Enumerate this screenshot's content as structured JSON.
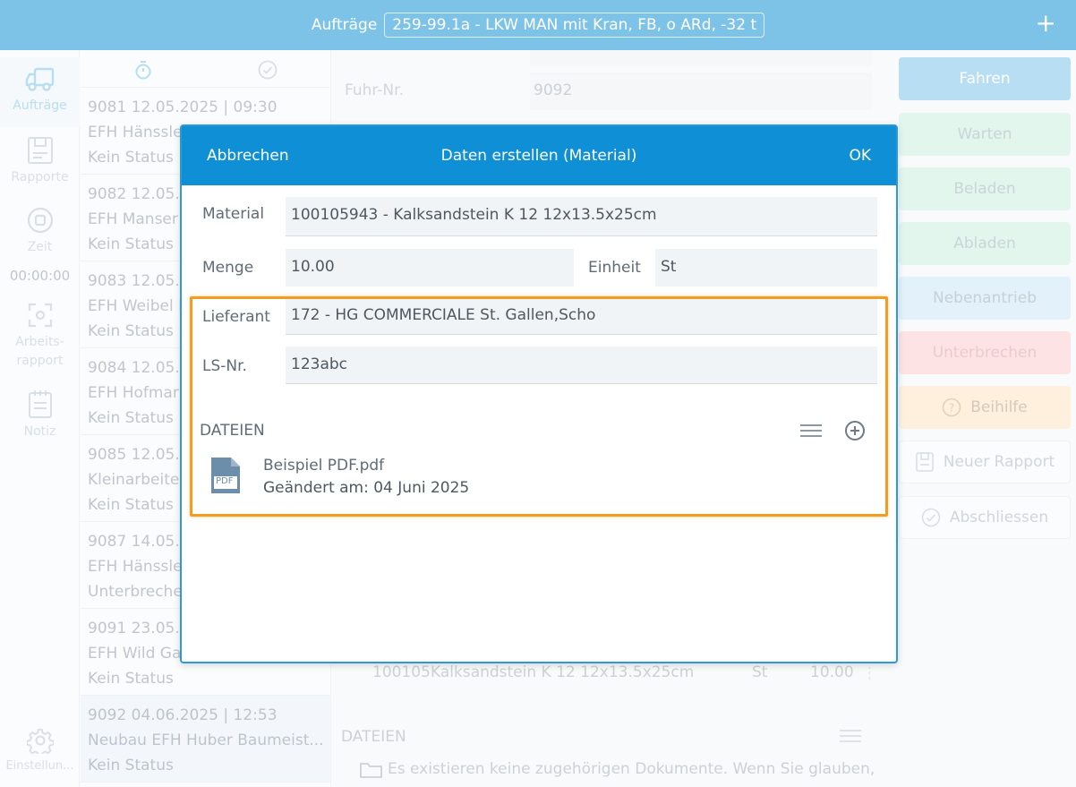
{
  "topbar": {
    "title": "Aufträge",
    "vehicle": "259-99.1a - LKW MAN mit Kran, FB, o ARd, -32 t",
    "add_icon": "plus-icon"
  },
  "nav": {
    "items": [
      {
        "label": "Aufträge",
        "icon": "truck-icon"
      },
      {
        "label": "Rapporte",
        "icon": "report-icon"
      },
      {
        "label": "Zeit",
        "icon": "stop-icon"
      },
      {
        "label": "Arbeits-",
        "label2": "rapport",
        "icon": "crosshair-icon"
      },
      {
        "label": "Notiz",
        "icon": "notepad-icon"
      },
      {
        "label": "Einstellun...",
        "icon": "gear-icon"
      }
    ],
    "time": "00:00:00"
  },
  "orders": [
    {
      "line1": "9081  12.05.2025 | 09:30",
      "line2": "EFH Hänssle",
      "line3": "Kein Status"
    },
    {
      "line1": "9082  12.05.",
      "line2": "EFH Manser",
      "line3": "Kein Status"
    },
    {
      "line1": "9083  12.05.",
      "line2": "EFH Weibel I",
      "line3": "Kein Status"
    },
    {
      "line1": "9084  12.05.",
      "line2": "EFH Hofmar",
      "line3": "Kein Status"
    },
    {
      "line1": "9085  12.05.",
      "line2": "Kleinarbeite",
      "line3": "Kein Status"
    },
    {
      "line1": "9087  14.05.",
      "line2": "EFH Hänssle",
      "line3": "Unterbreche"
    },
    {
      "line1": "9091  23.05.",
      "line2": "EFH Wild Ga",
      "line3": "Kein Status"
    },
    {
      "line1": "9092  04.06.2025 | 12:53",
      "line2": "Neubau EFH Huber Baumeist...",
      "line3": "Kein Status"
    }
  ],
  "main": {
    "fuhr_label": "Fuhr-Nr.",
    "fuhr_value": "9092",
    "material_row": {
      "code": "100105",
      "name": "Kalksandstein K 12 12x13.5x25cm",
      "unit": "St",
      "qty": "10.00"
    },
    "dateien_label": "DATEIEN",
    "no_docs": "Es existieren keine zugehörigen Dokumente. Wenn Sie glauben,"
  },
  "actions": {
    "fahren": "Fahren",
    "warten": "Warten",
    "beladen": "Beladen",
    "abladen": "Abladen",
    "nebenantrieb": "Nebenantrieb",
    "unterbrechen": "Unterbrechen",
    "beihilfe": "Beihilfe",
    "neuer_rapport": "Neuer Rapport",
    "abschliessen": "Abschliessen"
  },
  "dialog": {
    "cancel": "Abbrechen",
    "title": "Daten erstellen (Material)",
    "ok": "OK",
    "material_label": "Material",
    "material_value": "100105943 - Kalksandstein K 12 12x13.5x25cm",
    "menge_label": "Menge",
    "menge_value": "10.00",
    "einheit_label": "Einheit",
    "einheit_value": "St",
    "lieferant_label": "Lieferant",
    "lieferant_value": "172 - HG COMMERCIALE St. Gallen,Scho",
    "ls_label": "LS-Nr.",
    "ls_value": "123abc",
    "dateien_label": "DATEIEN",
    "file_name": "Beispiel PDF.pdf",
    "file_date": "Geändert am: 04 Juni 2025",
    "file_type": "PDF"
  },
  "colors": {
    "header": "#7dc3e8",
    "dialog_header": "#0f8fd6",
    "highlight": "#f39c21"
  }
}
